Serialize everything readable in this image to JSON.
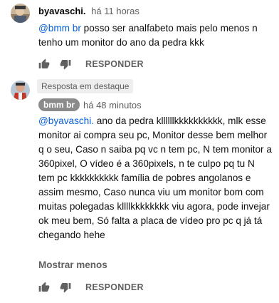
{
  "comments": [
    {
      "author": "byavaschi.",
      "time": "há 11 horas",
      "mention": "@bmm br",
      "text": "  posso ser analfabeto mais pelo menos n tenho um monitor do ano da pedra kkk",
      "reply_label": "RESPONDER"
    },
    {
      "pinned_label": "Resposta em destaque",
      "author": "bmm br",
      "time": "há 48 minutos",
      "mention": "@byavaschi.",
      "text": "  ano da pedra kllllllkkkkkkkkkk, mlk esse monitor ai compra seu pc, Monitor desse bem melhor q o seu, Caso n saiba pq vc n tem pc, N tem monitor a 360pixel, O vídeo é a 360pixels, n te culpo pq tu N tem pc kkkkkkkkkk família de pobres angolanos e assim mesmo, Caso nunca viu um monitor bom com muitas polegadas kllllkkkkkkkk viu agora, pode invejar ok meu bem, Só falta a placa de vídeo pro pc q já tá chegando hehe",
      "show_less_label": "Mostrar menos",
      "reply_label": "RESPONDER"
    }
  ],
  "icons": {
    "like": "thumbs-up-icon",
    "dislike": "thumbs-down-icon"
  },
  "colors": {
    "mention": "#065fd4",
    "meta": "#606060",
    "author_chip": "#8b8b8b"
  }
}
